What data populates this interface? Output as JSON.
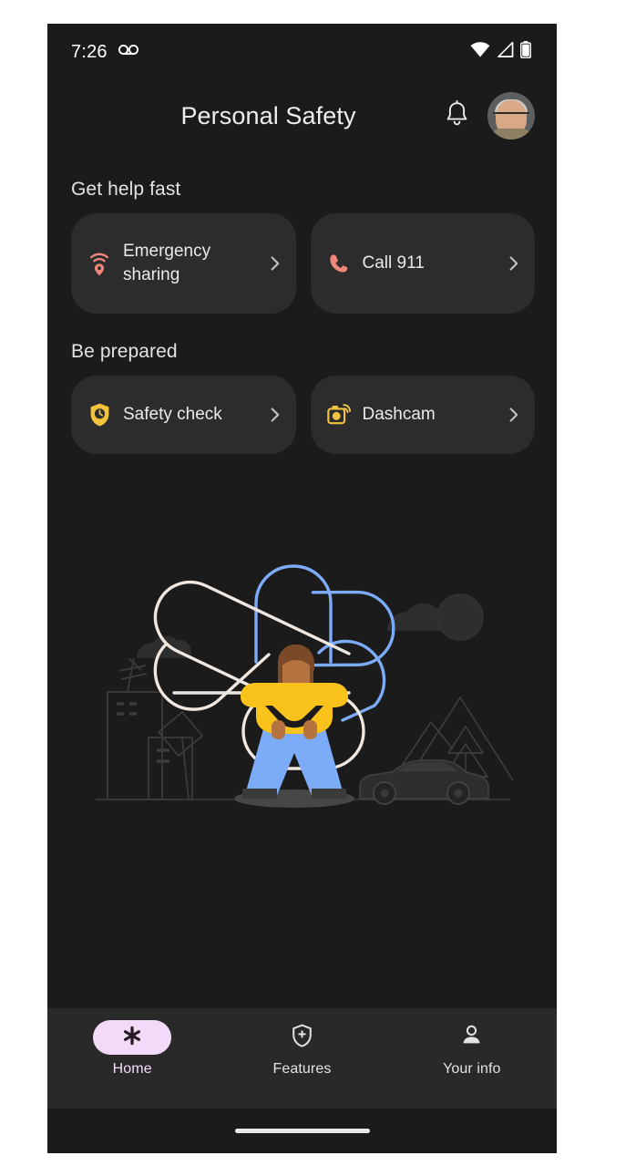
{
  "status_bar": {
    "time": "7:26",
    "icons": [
      "voicemail-icon",
      "wifi-icon",
      "cellular-signal-icon",
      "battery-icon"
    ]
  },
  "app_bar": {
    "title": "Personal Safety",
    "notification_icon": "bell-icon",
    "avatar": "user-avatar"
  },
  "sections": [
    {
      "heading": "Get help fast",
      "cards": [
        {
          "label": "Emergency sharing",
          "icon": "emergency-sharing-icon",
          "icon_color": "#f2877c",
          "chevron": "chevron-right-icon"
        },
        {
          "label": "Call 911",
          "icon": "phone-call-icon",
          "icon_color": "#f2877c",
          "chevron": "chevron-right-icon"
        }
      ]
    },
    {
      "heading": "Be prepared",
      "cards": [
        {
          "label": "Safety check",
          "icon": "shield-clock-icon",
          "icon_color": "#f2c43d",
          "chevron": "chevron-right-icon"
        },
        {
          "label": "Dashcam",
          "icon": "dashcam-camera-icon",
          "icon_color": "#f2c43d",
          "chevron": "chevron-right-icon"
        }
      ]
    }
  ],
  "illustration": {
    "name": "person-with-flower-illustration",
    "colors": {
      "sweater": "#f9c31c",
      "jeans": "#7cabf7",
      "skin": "#b5733f",
      "hair": "#7a4a28",
      "petal_white": "#efe7e0",
      "petal_blue": "#7cabf7",
      "scenery_outline": "#3a3a3a",
      "ground_shadow": "#4a4a4a"
    },
    "scenery": [
      "buildings",
      "antenna",
      "street-sign",
      "clouds",
      "mountains",
      "pine-tree",
      "car",
      "ground-line"
    ]
  },
  "bottom_nav": {
    "active": "Home",
    "items": [
      {
        "label": "Home",
        "icon": "asterisk-icon",
        "active": true
      },
      {
        "label": "Features",
        "icon": "shield-plus-icon",
        "active": false
      },
      {
        "label": "Your info",
        "icon": "person-icon",
        "active": false
      }
    ]
  },
  "theme": {
    "background": "#1b1b1b",
    "card_background": "#2c2c2c",
    "nav_background": "#292929",
    "accent_pink": "#f3daf8",
    "text_primary": "#e8eaed"
  }
}
